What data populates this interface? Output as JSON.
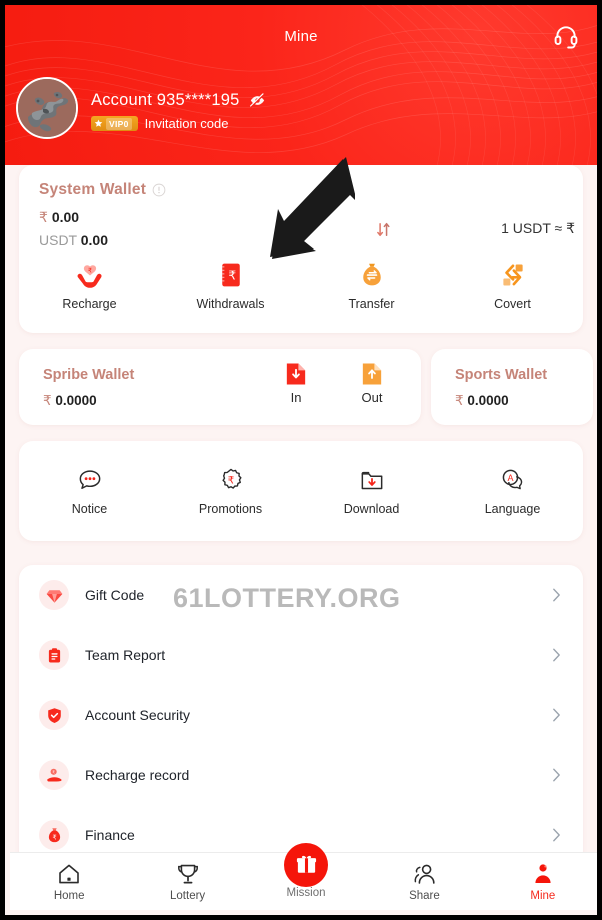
{
  "header": {
    "title": "Mine",
    "support_icon": "headset-icon",
    "account_label": "Account 935****195",
    "eye_icon": "eye-off-icon",
    "vip_level": "VIP0",
    "invitation_code_label": "Invitation code",
    "brand_color": "#f5241a"
  },
  "system_wallet": {
    "title": "System Wallet",
    "info_icon": "info-icon",
    "inr_currency": "₹",
    "inr_amount": "0.00",
    "usdt_currency": "USDT",
    "usdt_amount": "0.00",
    "swap_icon": "swap-vertical-icon",
    "rate_text": "1 USDT ≈ ₹",
    "actions": [
      {
        "label": "Recharge",
        "icon": "recharge-hands-heart-icon"
      },
      {
        "label": "Withdrawals",
        "icon": "withdraw-rupee-note-icon"
      },
      {
        "label": "Transfer",
        "icon": "transfer-moneybag-icon"
      },
      {
        "label": "Covert",
        "icon": "convert-arrows-icon"
      }
    ]
  },
  "spribe_wallet": {
    "title": "Spribe Wallet",
    "currency": "₹",
    "amount": "0.0000",
    "in_label": "In",
    "in_icon": "file-arrow-down-icon",
    "out_label": "Out",
    "out_icon": "file-arrow-up-icon"
  },
  "sports_wallet": {
    "title": "Sports Wallet",
    "currency": "₹",
    "amount": "0.0000"
  },
  "quick_actions": [
    {
      "label": "Notice",
      "icon": "speech-bubble-dots-icon"
    },
    {
      "label": "Promotions",
      "icon": "rupee-badge-icon"
    },
    {
      "label": "Download",
      "icon": "folder-download-icon"
    },
    {
      "label": "Language",
      "icon": "language-bubble-icon"
    }
  ],
  "watermark": "61LOTTERY.ORG",
  "menu": {
    "items": [
      {
        "label": "Gift Code",
        "icon": "diamond-icon",
        "chevron": "chevron-right-icon"
      },
      {
        "label": "Team Report",
        "icon": "clipboard-icon",
        "chevron": "chevron-right-icon"
      },
      {
        "label": "Account Security",
        "icon": "shield-check-icon",
        "chevron": "chevron-right-icon"
      },
      {
        "label": "Recharge record",
        "icon": "hand-coin-icon",
        "chevron": "chevron-right-icon"
      },
      {
        "label": "Finance",
        "icon": "money-bag-icon",
        "chevron": "chevron-right-icon"
      }
    ]
  },
  "tabbar": {
    "items": [
      {
        "label": "Home",
        "icon": "home-icon",
        "active": false
      },
      {
        "label": "Lottery",
        "icon": "trophy-icon",
        "active": false
      },
      {
        "label": "Mission",
        "icon": "gift-icon",
        "active": false
      },
      {
        "label": "Share",
        "icon": "people-icon",
        "active": false
      },
      {
        "label": "Mine",
        "icon": "person-icon",
        "active": true
      }
    ],
    "active_color": "#f52b1e"
  },
  "annotation": {
    "type": "arrow",
    "points_to": "Withdrawals",
    "color": "#1a1a1a"
  }
}
